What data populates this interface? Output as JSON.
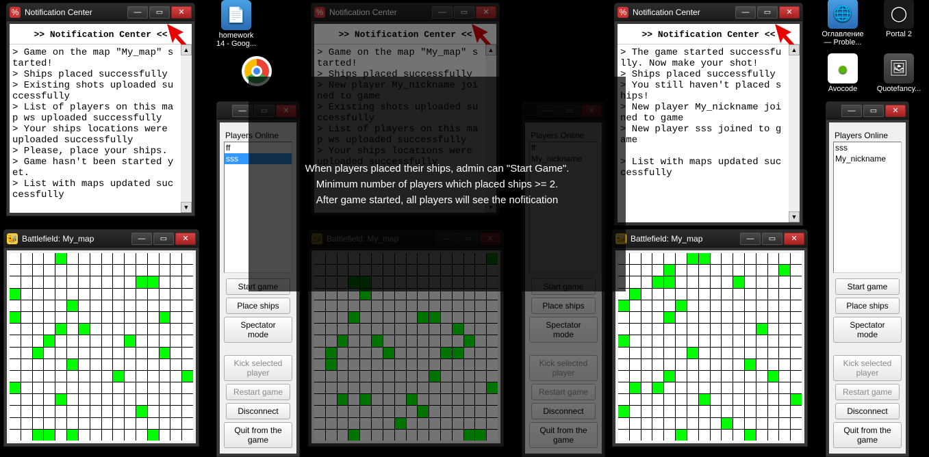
{
  "desktop_icons": {
    "homework": "homework 14 - Goog...",
    "oglavlenie": "Оглавление — Proble...",
    "portal2": "Portal 2",
    "avocode": "Avocode",
    "quotefancy": "Quotefancy..."
  },
  "window_titles": {
    "notification": "Notification Center",
    "battlefield": "Battlefield: My_map"
  },
  "notif_header": ">> Notification Center <<",
  "notif1_text": "> Game on the map \"My_map\" started!\n> Ships placed successfully\n> Existing shots uploaded successfully\n> List of players on this map ws uploaded successfully\n> Your ships locations were uploaded successfully\n> Please, place your ships.\n> Game hasn't been started yet.\n> List with maps updated successfully",
  "notif2_text": "> Game on the map \"My_map\" started!\n> Ships placed successfully\n> New player My_nickname joined to game\n> Existing shots uploaded successfully\n> List of players on this map ws uploaded successfully\n> Your ships locations were uploaded successfully\n",
  "notif3_text": "> The game started successfully. Now make your shot!\n> Ships placed successfully\n> You still haven't placed ships!\n> New player My_nickname joined to game\n> New player sss joined to game\n\n> List with maps updated successfully",
  "players_label": "Players Online",
  "panel1_players": [
    "ff",
    "sss"
  ],
  "panel2_players": [
    "ff",
    "My_nickname"
  ],
  "panel3_players": [
    "sss",
    "My_nickname"
  ],
  "panel1_selected": 1,
  "buttons": {
    "start": "Start game",
    "place": "Place ships",
    "spectator": "Spectator mode",
    "kick": "Kick selected player",
    "restart": "Restart game",
    "disconnect": "Disconnect",
    "quit": "Quit from the game"
  },
  "overlay_lines": [
    "When players placed their ships, admin can \"Start Game\".",
    "Minimum number of players which placed ships >= 2.",
    "After game started, all players will see the nofitication"
  ],
  "bf1_ships": [
    [
      0,
      4
    ],
    [
      2,
      11
    ],
    [
      2,
      12
    ],
    [
      3,
      0
    ],
    [
      4,
      5
    ],
    [
      5,
      0
    ],
    [
      5,
      13
    ],
    [
      6,
      4
    ],
    [
      6,
      6
    ],
    [
      7,
      3
    ],
    [
      7,
      10
    ],
    [
      8,
      2
    ],
    [
      8,
      13
    ],
    [
      9,
      5
    ],
    [
      10,
      9
    ],
    [
      10,
      15
    ],
    [
      11,
      0
    ],
    [
      12,
      4
    ],
    [
      13,
      11
    ],
    [
      15,
      2
    ],
    [
      15,
      3
    ],
    [
      15,
      5
    ],
    [
      15,
      12
    ]
  ],
  "bf2_ships": [
    [
      0,
      15
    ],
    [
      2,
      3
    ],
    [
      2,
      4
    ],
    [
      3,
      4
    ],
    [
      5,
      3
    ],
    [
      5,
      9
    ],
    [
      5,
      10
    ],
    [
      6,
      12
    ],
    [
      7,
      2
    ],
    [
      7,
      5
    ],
    [
      7,
      13
    ],
    [
      8,
      1
    ],
    [
      8,
      6
    ],
    [
      8,
      11
    ],
    [
      8,
      12
    ],
    [
      9,
      1
    ],
    [
      10,
      10
    ],
    [
      11,
      15
    ],
    [
      12,
      2
    ],
    [
      12,
      4
    ],
    [
      12,
      8
    ],
    [
      13,
      9
    ],
    [
      14,
      7
    ],
    [
      15,
      3
    ],
    [
      15,
      13
    ],
    [
      15,
      14
    ]
  ],
  "bf3_ships": [
    [
      0,
      6
    ],
    [
      0,
      7
    ],
    [
      1,
      4
    ],
    [
      1,
      14
    ],
    [
      2,
      3
    ],
    [
      2,
      4
    ],
    [
      2,
      10
    ],
    [
      3,
      1
    ],
    [
      4,
      0
    ],
    [
      4,
      5
    ],
    [
      5,
      4
    ],
    [
      6,
      12
    ],
    [
      7,
      0
    ],
    [
      8,
      6
    ],
    [
      9,
      11
    ],
    [
      10,
      4
    ],
    [
      10,
      13
    ],
    [
      11,
      1
    ],
    [
      11,
      3
    ],
    [
      12,
      7
    ],
    [
      12,
      15
    ],
    [
      13,
      0
    ],
    [
      14,
      9
    ],
    [
      15,
      5
    ],
    [
      15,
      11
    ]
  ]
}
